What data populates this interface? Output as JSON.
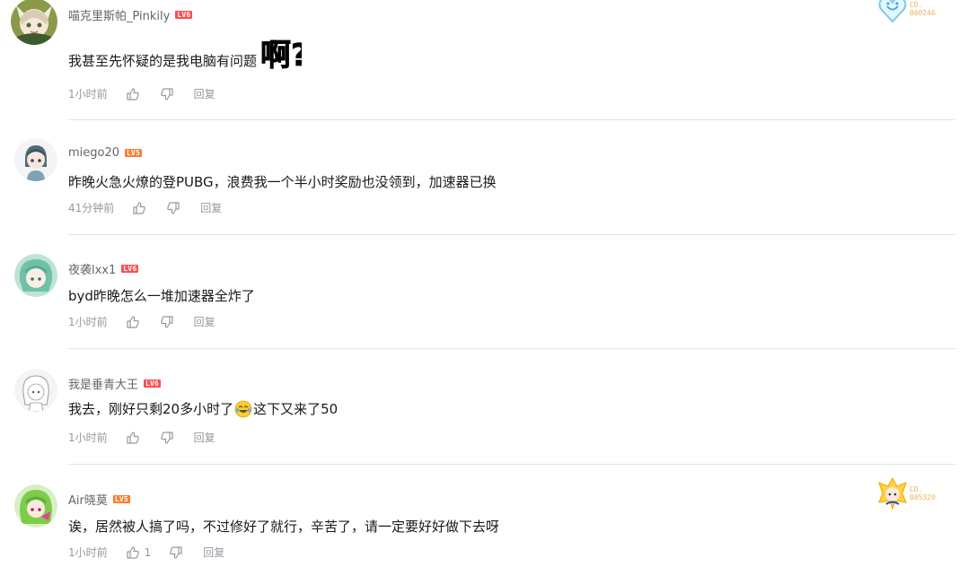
{
  "comments": [
    {
      "username": "喵克里斯帕_Pinkily",
      "level": "LV6",
      "text": "我甚至先怀疑的是我电脑有问题",
      "sticker": "啊?",
      "time": "1小时前",
      "likes": "",
      "reply": "回复",
      "badge": {
        "label": "CD.",
        "number": "000246"
      }
    },
    {
      "username": "miego20",
      "level": "LV5",
      "text": "昨晚火急火燎的登PUBG，浪费我一个半小时奖励也没领到，加速器已换",
      "time": "41分钟前",
      "likes": "",
      "reply": "回复"
    },
    {
      "username": "夜袭lxx1",
      "level": "LV6",
      "text": "byd昨晚怎么一堆加速器全炸了",
      "time": "1小时前",
      "likes": "",
      "reply": "回复"
    },
    {
      "username": "我是垂青大王",
      "level": "LV6",
      "text": "我去，刚好只剩20多小时了",
      "text_after": "这下又来了50",
      "emoji": "laugh-cry-emoji",
      "time": "1小时前",
      "likes": "",
      "reply": "回复"
    },
    {
      "username": "Air晓莫",
      "level": "LV5",
      "text": "诶，居然被人搞了吗，不过修好了就行，辛苦了，请一定要好好做下去呀",
      "time": "1小时前",
      "likes": "1",
      "reply": "回复",
      "badge": {
        "label": "CD.",
        "number": "005320"
      }
    }
  ],
  "colors": {
    "username": "#61666d",
    "text": "#18191c",
    "meta": "#9499a0",
    "lv6": "#ff4d4f",
    "lv5": "#ff7b2c",
    "badge_number": "#e9b35a",
    "divider": "#e3e5e7"
  },
  "icons": [
    "like-icon",
    "dislike-icon"
  ]
}
